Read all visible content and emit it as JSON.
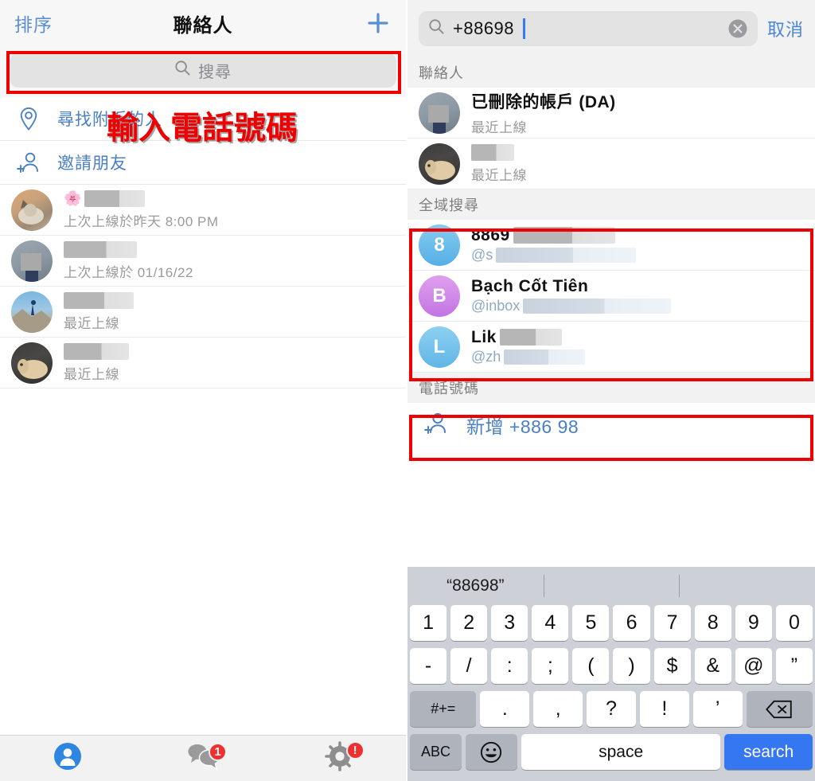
{
  "left": {
    "nav": {
      "sort_label": "排序",
      "title": "聯絡人",
      "add_icon": "plus-icon"
    },
    "search": {
      "placeholder": "搜尋",
      "icon": "search-icon"
    },
    "actions": [
      {
        "icon": "location-pin-icon",
        "label": "尋找附近的人"
      },
      {
        "icon": "add-person-icon",
        "label": "邀請朋友"
      }
    ],
    "contacts": [
      {
        "avatar": "cat-photo",
        "emoji": "🌸",
        "name_redacted": true,
        "status": "上次上線於昨天 8:00 PM"
      },
      {
        "avatar": "person-photo",
        "name_redacted": true,
        "status": "上次上線於 01/16/22"
      },
      {
        "avatar": "mountain-photo",
        "name_redacted": true,
        "status": "最近上線"
      },
      {
        "avatar": "dog-photo",
        "name_redacted": true,
        "status": "最近上線"
      }
    ],
    "annotation": {
      "text": "輸入電話號碼",
      "color": "#ee0000"
    },
    "tabs": [
      {
        "name": "contacts-tab",
        "icon": "person-icon",
        "active": true,
        "badge": ""
      },
      {
        "name": "chats-tab",
        "icon": "chat-bubbles-icon",
        "active": false,
        "badge": "1"
      },
      {
        "name": "settings-tab",
        "icon": "gear-icon",
        "active": false,
        "badge": "!"
      }
    ]
  },
  "right": {
    "search": {
      "icon": "search-icon",
      "value": "+88698",
      "clear_icon": "clear-circle-icon",
      "cancel_label": "取消"
    },
    "sections": [
      {
        "title": "聯絡人"
      },
      {
        "title": "全域搜尋"
      },
      {
        "title": "電話號碼"
      }
    ],
    "contacts_results": [
      {
        "avatar": "person-photo",
        "name": "已刪除的帳戶 (DA)",
        "status": "最近上線",
        "redacted": false
      },
      {
        "avatar": "dog-photo",
        "name": "",
        "status": "最近上線",
        "redacted": true
      }
    ],
    "global_results": [
      {
        "initial": "8",
        "color": "#6fc0ec",
        "name": "8869",
        "name_redacted": true,
        "handle": "@s",
        "handle_redacted": true
      },
      {
        "initial": "B",
        "color": "#cf8ae8",
        "name": "Bạch Cốt Tiên",
        "name_redacted": false,
        "handle": "@inbox",
        "handle_redacted": true
      },
      {
        "initial": "L",
        "color": "#76c2ea",
        "name": "Lik",
        "name_redacted": true,
        "handle": "@zh",
        "handle_redacted": true
      }
    ],
    "phone_action": {
      "icon": "add-person-icon",
      "label": "新增 +886 98"
    },
    "keyboard": {
      "prediction": "“88698”",
      "row1": [
        "1",
        "2",
        "3",
        "4",
        "5",
        "6",
        "7",
        "8",
        "9",
        "0"
      ],
      "row2": [
        "-",
        "/",
        ":",
        ";",
        "(",
        ")",
        "$",
        "&",
        "@",
        "”"
      ],
      "row3_fn": "#+=",
      "row3": [
        ".",
        ",",
        "?",
        "!",
        "’"
      ],
      "row3_back": "backspace-icon",
      "row4_abc": "ABC",
      "row4_emoji": "emoji-icon",
      "row4_space": "space",
      "row4_search": "search"
    }
  },
  "colors": {
    "accent_blue": "#4a86d8",
    "link_blue": "#4a7fc1",
    "annotation_red": "#ee0000",
    "keyboard_bg": "#cdd0d6",
    "return_blue": "#3477f0"
  }
}
